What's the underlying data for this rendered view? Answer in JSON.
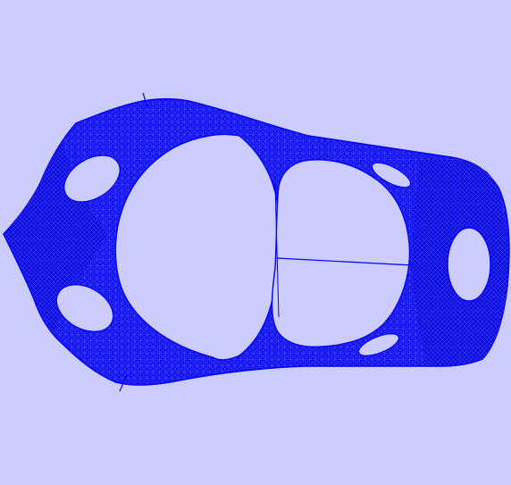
{
  "viewport": {
    "background_color": "#ccccff",
    "mesh_color": "#1010f0",
    "mesh_dense_color": "#0a0ad8",
    "hole_color": "#ccccff"
  }
}
